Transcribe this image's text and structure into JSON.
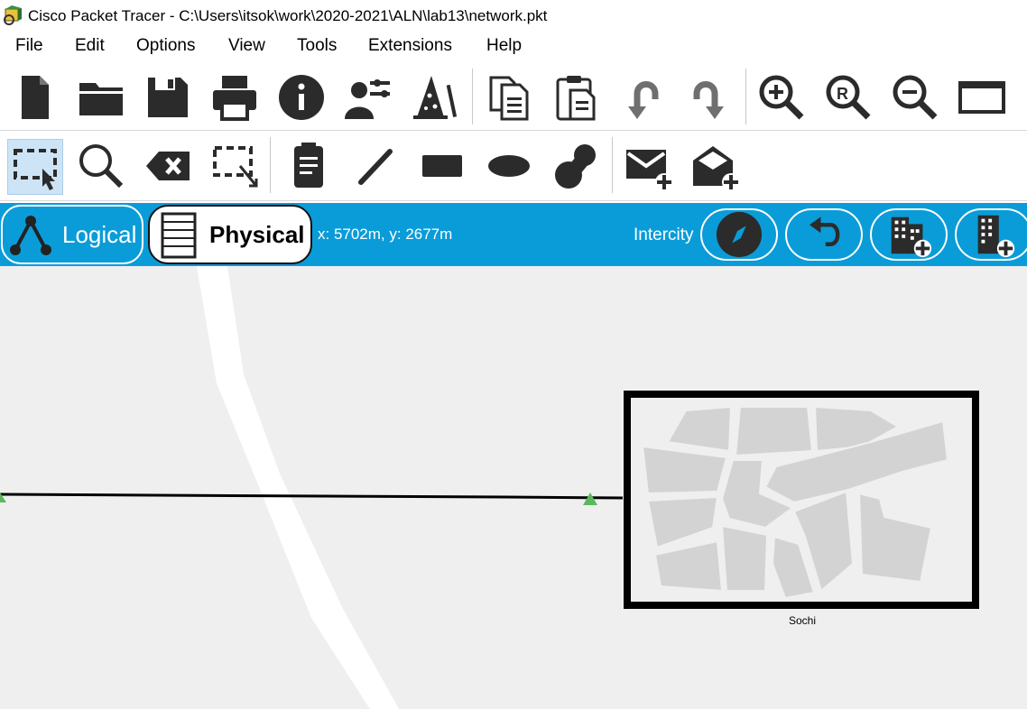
{
  "window": {
    "title": "Cisco Packet Tracer - C:\\Users\\itsok\\work\\2020-2021\\ALN\\lab13\\network.pkt"
  },
  "menu": {
    "items": [
      "File",
      "Edit",
      "Options",
      "View",
      "Tools",
      "Extensions",
      "Help"
    ]
  },
  "toolbar_main": {
    "icons": [
      "new-file-icon",
      "open-folder-icon",
      "save-icon",
      "print-icon",
      "info-icon",
      "user-settings-icon",
      "wizard-icon",
      "copy-icon",
      "paste-icon",
      "undo-icon",
      "redo-icon",
      "zoom-in-icon",
      "zoom-reset-icon",
      "zoom-out-icon",
      "window-icon"
    ]
  },
  "toolbar_tools": {
    "icons": [
      "select-icon",
      "inspect-icon",
      "delete-icon",
      "resize-icon",
      "note-icon",
      "line-icon",
      "rectangle-icon",
      "ellipse-icon",
      "freeform-icon",
      "add-simple-pdu-icon",
      "add-complex-pdu-icon"
    ],
    "selected": "select-icon"
  },
  "mode_bar": {
    "logical_label": "Logical",
    "physical_label": "Physical",
    "active_mode": "Physical",
    "coordinates": "x: 5702m, y: 2677m",
    "location_label": "Intercity",
    "accent_color": "#0a9cd8",
    "buttons": [
      "navigation-icon",
      "back-icon",
      "new-city-icon",
      "new-building-icon"
    ]
  },
  "canvas": {
    "city_label": "Sochi",
    "cable_color": "#000000",
    "link_status_color": "#5cb85c"
  }
}
